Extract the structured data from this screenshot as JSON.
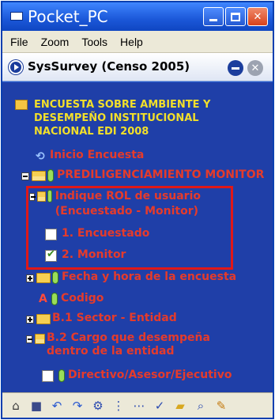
{
  "window": {
    "title": "Pocket_PC",
    "controls": {
      "minimize": "minimize",
      "maximize": "maximize",
      "close": "✕"
    }
  },
  "menu": [
    "File",
    "Zoom",
    "Tools",
    "Help"
  ],
  "app": {
    "title": "SysSurvey (Censo 2005)",
    "close_glyph": "✕"
  },
  "tree": {
    "root": "ENCUESTA SOBRE AMBIENTE Y\nDESEMPEÑO INSTITUCIONAL\nNACIONAL EDI 2008",
    "nodes": {
      "inicio": "Inicio Encuesta",
      "prediligenciamiento": "PREDILIGENCIAMIENTO MONITOR",
      "rol": "Indique ROL de usuario (Encuestado - Monitor)",
      "encuestado": "1. Encuestado",
      "monitor": "2. Monitor",
      "fecha": "Fecha y hora de la encuesta",
      "codigo": "Codigo",
      "sector": "B.1 Sector - Entidad",
      "cargo": "B.2 Cargo que desempeña dentro de la entidad",
      "directivo": "Directivo/Asesor/Ejecutivo"
    },
    "checked": {
      "encuestado": false,
      "monitor": true
    }
  },
  "toolbar": [
    {
      "icon": "home-icon",
      "glyph": "⌂"
    },
    {
      "icon": "save-icon",
      "glyph": "■"
    },
    {
      "icon": "undo-icon",
      "glyph": "↶"
    },
    {
      "icon": "redo-icon",
      "glyph": "↷"
    },
    {
      "icon": "tool-icon",
      "glyph": "⚙"
    },
    {
      "icon": "tree-icon",
      "glyph": "⋮"
    },
    {
      "icon": "network-icon",
      "glyph": "⋯"
    },
    {
      "icon": "check-icon",
      "glyph": "✓"
    },
    {
      "icon": "folder-icon",
      "glyph": "▰"
    },
    {
      "icon": "search-icon",
      "glyph": "⌕"
    },
    {
      "icon": "edit-icon",
      "glyph": "✎"
    }
  ],
  "colors": {
    "tree_background": "#1f3fa8",
    "node_text": "#e53b2b",
    "root_text": "#f2df2a",
    "highlight": "#e01818"
  }
}
